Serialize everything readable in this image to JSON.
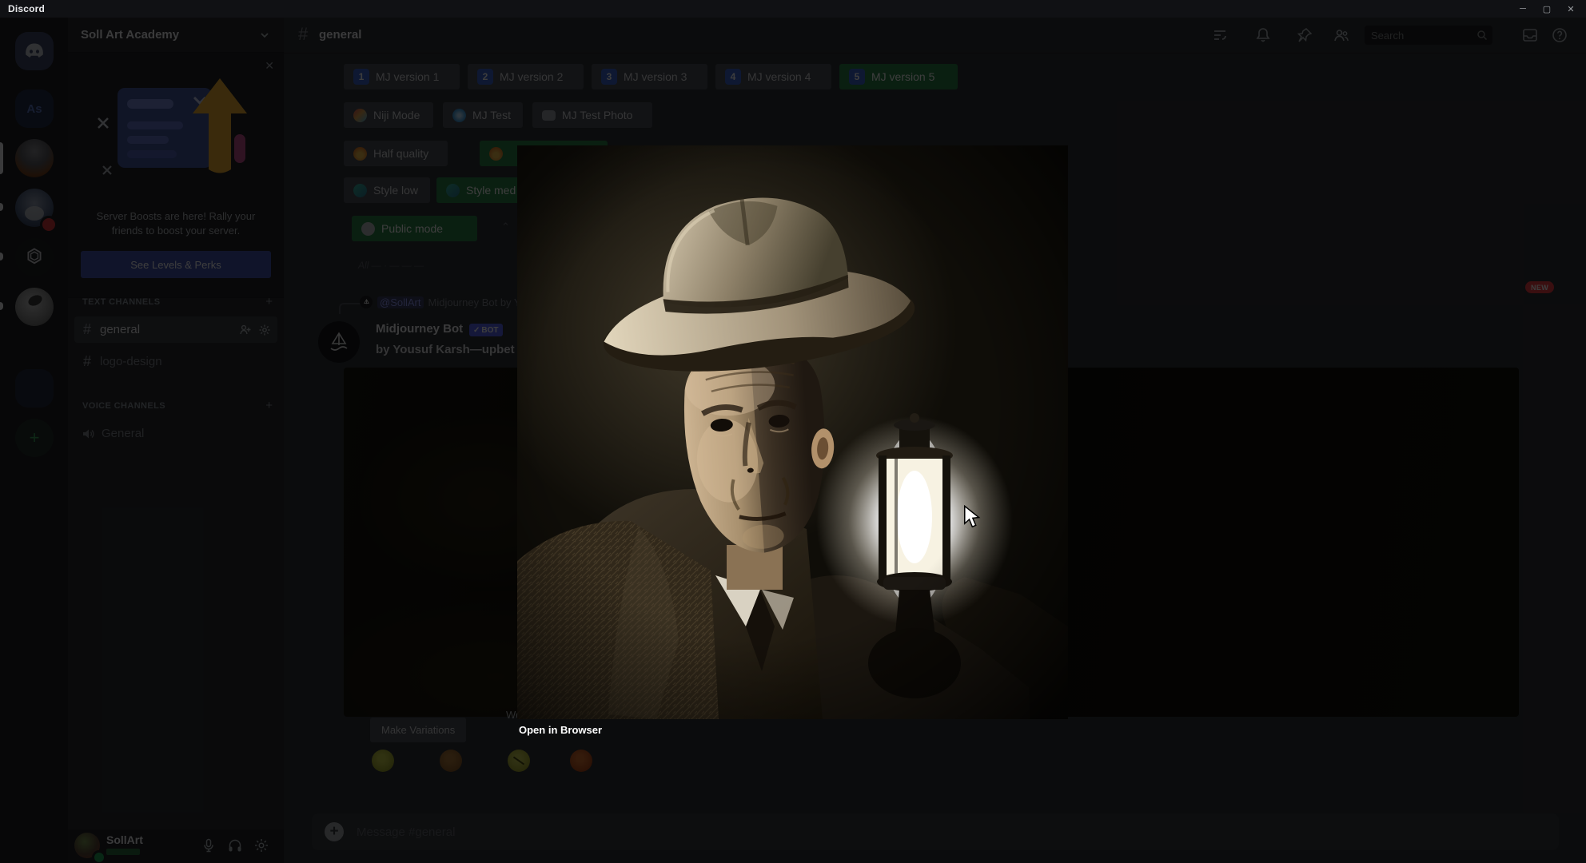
{
  "titlebar": {
    "app_name": "Discord"
  },
  "window_controls": {
    "minimize": "─",
    "maximize": "▢",
    "close": "✕"
  },
  "rail": {
    "server_as_initials": "As",
    "add_server": "+"
  },
  "sidebar": {
    "server_name": "Soll Art Academy",
    "boost": {
      "close": "✕",
      "line1": "Server Boosts are here! Rally your",
      "line2": "friends to boost your server.",
      "button": "See Levels & Perks"
    },
    "hash": "#",
    "add": "+",
    "text_channels_header": "TEXT CHANNELS",
    "voice_channels_header": "VOICE CHANNELS",
    "channels": [
      {
        "name": "general"
      },
      {
        "name": "logo-design"
      }
    ],
    "voice_channels": [
      {
        "name": "General"
      }
    ],
    "user": {
      "name": "SollArt"
    }
  },
  "header": {
    "hash": "#",
    "channel": "general",
    "search_placeholder": "Search"
  },
  "settings": {
    "rows": [
      {
        "buttons": [
          {
            "num": "1",
            "label": "MJ version 1"
          },
          {
            "num": "2",
            "label": "MJ version 2"
          },
          {
            "num": "3",
            "label": "MJ version 3"
          },
          {
            "num": "4",
            "label": "MJ version 4"
          },
          {
            "num": "5",
            "label": "MJ version 5"
          }
        ]
      },
      {
        "buttons": [
          {
            "label": "Niji Mode"
          },
          {
            "label": "MJ Test"
          },
          {
            "label": "MJ Test Photo"
          }
        ]
      },
      {
        "buttons": [
          {
            "label": "Half quality"
          },
          {
            "label": ""
          }
        ]
      },
      {
        "buttons": [
          {
            "label": "Style low"
          },
          {
            "label": "Style med"
          }
        ]
      },
      {
        "buttons": [
          {
            "label": "Public mode"
          }
        ]
      }
    ],
    "partial_marker": "⌃",
    "footnote": "All — · — — —"
  },
  "message": {
    "reply_mention": "@SollArt",
    "reply_preview": "Midjourney Bot by Y",
    "author": "Midjourney Bot",
    "bot_badge_check": "✓",
    "bot_badge": "BOT",
    "content": "by Yousuf Karsh—upbet",
    "actions": {
      "make_variations": "Make Variations",
      "web": "Web",
      "web_icon": "↗"
    },
    "reactions": [
      {
        "emoji": "😄"
      },
      {
        "emoji": "😍"
      },
      {
        "emoji": "😵"
      },
      {
        "emoji": "🔥"
      }
    ],
    "new_badge": "NEW"
  },
  "lightbox": {
    "caption": "Open in Browser"
  },
  "composer": {
    "placeholder": "Message #general"
  },
  "colors": {
    "success_green": "#2d8049",
    "blurple": "#5865f2",
    "danger_red": "#f23f43",
    "dim_overlay": "rgba(0,0,0,0.76)"
  }
}
